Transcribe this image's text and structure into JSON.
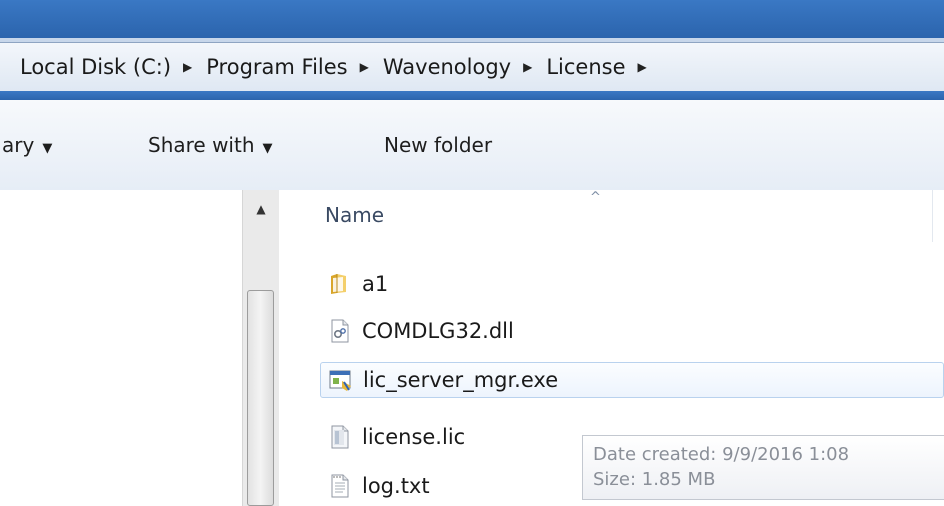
{
  "address_bar": {
    "crumbs": [
      "Local Disk (C:)",
      "Program Files",
      "Wavenology",
      "License"
    ],
    "separator": "▶"
  },
  "toolbar": {
    "library_label": "ary",
    "share_with_label": "Share with",
    "new_folder_label": "New folder",
    "caret": "▼"
  },
  "file_list": {
    "column_header": "Name",
    "sort_indicator": "^",
    "files": [
      {
        "name": "a1",
        "icon": "folder-icon"
      },
      {
        "name": "COMDLG32.dll",
        "icon": "dll-file-icon"
      },
      {
        "name": "lic_server_mgr.exe",
        "icon": "exe-file-icon",
        "selected": true
      },
      {
        "name": "license.lic",
        "icon": "lic-file-icon"
      },
      {
        "name": "log.txt",
        "icon": "text-file-icon"
      }
    ]
  },
  "tooltip": {
    "date_created": "Date created: 9/9/2016 1:08",
    "size": "Size: 1.85 MB"
  },
  "scrollbar": {
    "up_arrow": "▲"
  }
}
